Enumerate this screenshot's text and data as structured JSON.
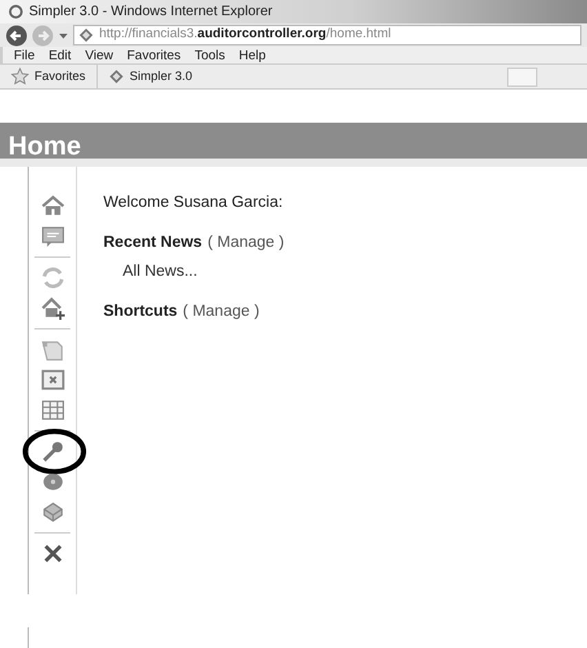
{
  "window": {
    "title": "Simpler 3.0 - Windows Internet Explorer"
  },
  "address_bar": {
    "url_prefix": "http://financials3.",
    "url_domain": "auditorcontroller.org",
    "url_path": "/home.html"
  },
  "menu": [
    "File",
    "Edit",
    "View",
    "Favorites",
    "Tools",
    "Help"
  ],
  "favorites_bar": {
    "favorites": "Favorites",
    "tab": "Simpler 3.0"
  },
  "page": {
    "title": "Home",
    "welcome": "Welcome Susana Garcia:",
    "sections": [
      {
        "heading": "Recent News",
        "action": "( Manage )",
        "links": [
          "All News..."
        ]
      },
      {
        "heading": "Shortcuts",
        "action": "( Manage )"
      }
    ]
  },
  "sidebar": [
    {
      "items": [
        {
          "kind": "home",
          "highlighted": false
        },
        {
          "kind": "comment",
          "highlighted": false
        }
      ]
    },
    {
      "items": [
        {
          "kind": "refresh",
          "highlighted": false
        },
        {
          "kind": "home-plus",
          "highlighted": false
        }
      ]
    },
    {
      "items": [
        {
          "kind": "document",
          "highlighted": false
        },
        {
          "kind": "window-x",
          "highlighted": false
        },
        {
          "kind": "grid",
          "highlighted": false
        }
      ]
    },
    {
      "items": [
        {
          "kind": "key",
          "highlighted": true
        },
        {
          "kind": "disc",
          "highlighted": false
        },
        {
          "kind": "box",
          "highlighted": false
        }
      ]
    },
    {
      "items": [
        {
          "kind": "close",
          "highlighted": false
        }
      ]
    }
  ]
}
